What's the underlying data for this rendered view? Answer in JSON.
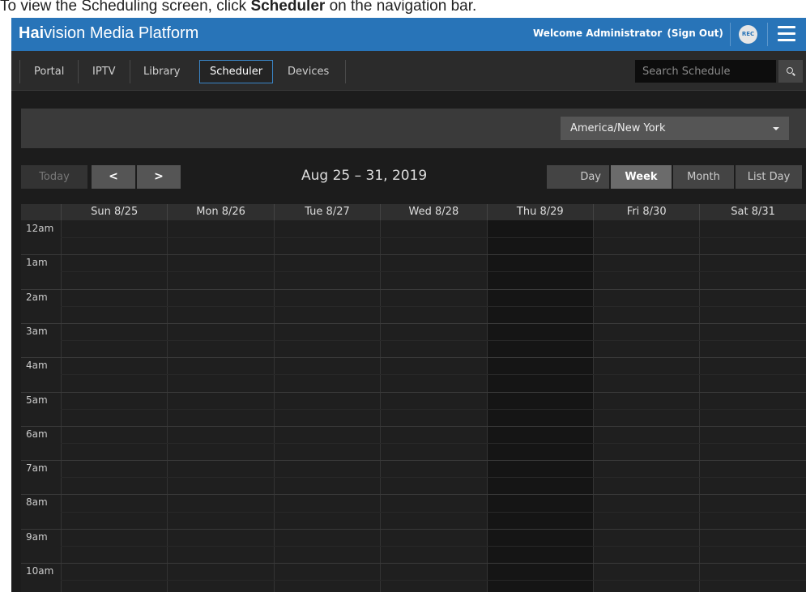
{
  "caption": {
    "prefix": "To view the Scheduling screen, click ",
    "bold": "Scheduler",
    "suffix": " on the navigation bar."
  },
  "header": {
    "brand_bold": "Hai",
    "brand_rest": "vision Media Platform",
    "welcome": "Welcome Administrator",
    "signout": "(Sign Out)",
    "rec_label": "REC",
    "accent_color": "#2874b8"
  },
  "nav": {
    "items": [
      {
        "label": "Portal"
      },
      {
        "label": "IPTV"
      },
      {
        "label": "Library"
      },
      {
        "label": "Scheduler",
        "active": true
      },
      {
        "label": "Devices"
      }
    ],
    "search_placeholder": "Search Schedule"
  },
  "timezone": {
    "selected": "America/New York"
  },
  "toolbar": {
    "today": "Today",
    "prev": "<",
    "next": ">",
    "range_title": "Aug 25 – 31, 2019",
    "views": [
      "Day",
      "Week",
      "Month",
      "List Day"
    ],
    "active_view": "Week"
  },
  "calendar": {
    "days": [
      "Sun 8/25",
      "Mon 8/26",
      "Tue 8/27",
      "Wed 8/28",
      "Thu 8/29",
      "Fri 8/30",
      "Sat 8/31"
    ],
    "today_index": 4,
    "times": [
      "12am",
      "1am",
      "2am",
      "3am",
      "4am",
      "5am",
      "6am",
      "7am",
      "8am",
      "9am",
      "10am"
    ]
  }
}
